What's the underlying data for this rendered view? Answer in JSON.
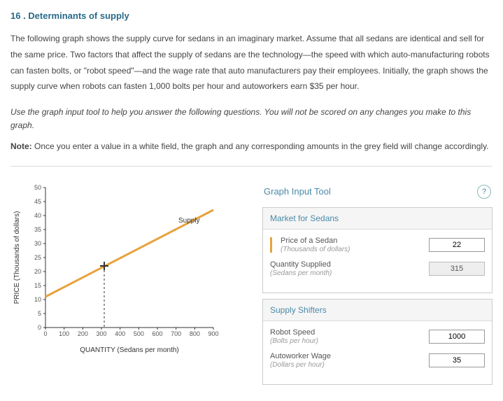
{
  "question": {
    "number_title": "16 . Determinants of supply",
    "paragraph": "The following graph shows the supply curve for sedans in an imaginary market. Assume that all sedans are identical and sell for the same price. Two factors that affect the supply of sedans are the technology—the speed with which auto-manufacturing robots can fasten bolts, or \"robot speed\"—and the wage rate that auto manufacturers pay their employees. Initially, the graph shows the supply curve when robots can fasten 1,000 bolts per hour and autoworkers earn $35 per hour.",
    "instruction": "Use the graph input tool to help you answer the following questions. You will not be scored on any changes you make to this graph.",
    "note_label": "Note:",
    "note_text": " Once you enter a value in a white field, the graph and any corresponding amounts in the grey field will change accordingly."
  },
  "tool": {
    "header": "Graph Input Tool",
    "help": "?",
    "market_header": "Market for Sedans",
    "price_label": "Price of a Sedan",
    "price_sub": "(Thousands of dollars)",
    "price_value": "22",
    "qty_label": "Quantity Supplied",
    "qty_sub": "(Sedans per month)",
    "qty_value": "315",
    "shifters_header": "Supply Shifters",
    "robot_label": "Robot Speed",
    "robot_sub": "(Bolts per hour)",
    "robot_value": "1000",
    "wage_label": "Autoworker Wage",
    "wage_sub": "(Dollars per hour)",
    "wage_value": "35"
  },
  "chart_data": {
    "type": "line",
    "title": "",
    "xlabel": "QUANTITY (Sedans per month)",
    "ylabel": "PRICE (Thousands of dollars)",
    "x_ticks": [
      0,
      100,
      200,
      300,
      400,
      500,
      600,
      700,
      800,
      900
    ],
    "y_ticks": [
      0,
      5,
      10,
      15,
      20,
      25,
      30,
      35,
      40,
      45,
      50
    ],
    "xlim": [
      0,
      900
    ],
    "ylim": [
      0,
      50
    ],
    "series": [
      {
        "name": "Supply",
        "color": "#e8a23d",
        "points": [
          [
            0,
            11
          ],
          [
            900,
            42
          ]
        ]
      }
    ],
    "marker": {
      "x": 315,
      "y": 22,
      "color": "#333"
    },
    "legend_label": "Supply"
  }
}
